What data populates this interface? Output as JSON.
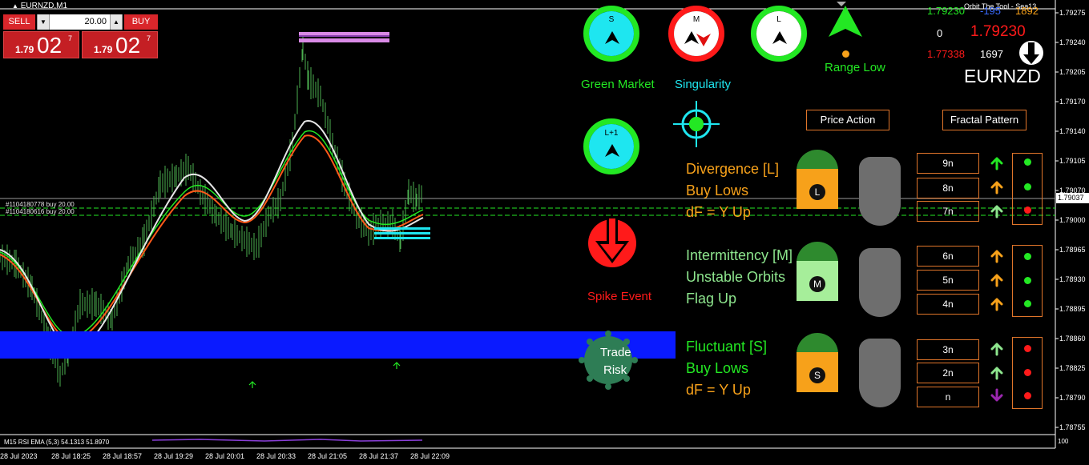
{
  "window": {
    "title": "EURNZD,M1"
  },
  "trade": {
    "sell_label": "SELL",
    "buy_label": "BUY",
    "lot": "20.00",
    "sell_price": {
      "prefix": "1.79",
      "big": "02",
      "sup": "7"
    },
    "buy_price": {
      "prefix": "1.79",
      "big": "02",
      "sup": "7"
    }
  },
  "chart": {
    "order_line_1": "#1104180778 buy 20.00",
    "order_line_2": "#1104180616 buy 20.00",
    "price_axis": [
      "1.79275",
      "1.79240",
      "1.79205",
      "1.79170",
      "1.79140",
      "1.79105",
      "1.79070",
      "1.79037",
      "1.79000",
      "1.78965",
      "1.78930",
      "1.78895",
      "1.78860",
      "1.78825",
      "1.78790",
      "1.78755"
    ],
    "current_price": "1.79037",
    "time_axis": [
      "28 Jul 2023",
      "28 Jul 18:25",
      "28 Jul 18:57",
      "28 Jul 19:29",
      "28 Jul 20:01",
      "28 Jul 20:33",
      "28 Jul 21:05",
      "28 Jul 21:37",
      "28 Jul 22:09"
    ],
    "subwindow_label": "M15  RSI  EMA (5,3) 54.1313 51.8970",
    "subwindow_axis": "100"
  },
  "header_right": {
    "tool_name": "Orbit The Tool - Sea13",
    "price_green": "1.79230",
    "neg_value": "-195",
    "pos_value": "1892",
    "zero": "0",
    "price_red_big": "1.79230",
    "price_red_small": "1.77338",
    "count": "1697",
    "symbol": "EURNZD"
  },
  "indicators": {
    "s": {
      "letter": "S"
    },
    "m": {
      "letter": "M"
    },
    "l": {
      "letter": "L"
    },
    "l1": {
      "letter": "L+1"
    },
    "range_low": "Range Low",
    "green_market": "Green Market",
    "singularity": "Singularity",
    "spike_event": "Spike Event",
    "trade_risk_1": "Trade",
    "trade_risk_2": "Risk"
  },
  "sections": {
    "price_action": "Price Action",
    "fractal_pattern": "Fractal Pattern",
    "l_block": {
      "line1": "Divergence [L]",
      "line2": "Buy Lows",
      "line3": "dF = Y Up",
      "gauge_letter": "L"
    },
    "m_block": {
      "line1": "Intermittency [M]",
      "line2": "Unstable Orbits",
      "line3": "Flag Up",
      "gauge_letter": "M"
    },
    "s_block": {
      "line1": "Fluctuant [S]",
      "line2": "Buy Lows",
      "line3": "dF = Y Up",
      "gauge_letter": "S"
    }
  },
  "fractal": {
    "tags": [
      "9n",
      "8n",
      "7n",
      "6n",
      "5n",
      "4n",
      "3n",
      "2n",
      "n"
    ]
  },
  "colors": {
    "green": "#23e823",
    "orange": "#f7a11a",
    "red": "#ff1a1a",
    "cyan": "#1ee6f0",
    "blue_band": "#0a1aff",
    "magenta": "#d98ae6"
  }
}
